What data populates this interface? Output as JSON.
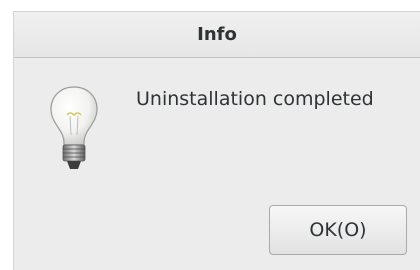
{
  "dialog": {
    "title": "Info",
    "icon": "lightbulb-icon",
    "message": "Uninstallation completed",
    "ok_label": "OK(O)"
  }
}
